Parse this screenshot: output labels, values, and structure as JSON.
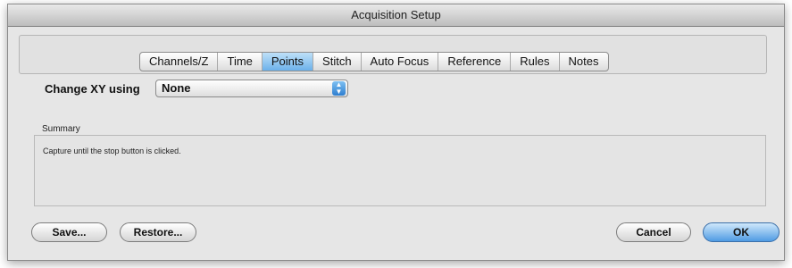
{
  "window": {
    "title": "Acquisition Setup"
  },
  "tabs": [
    {
      "label": "Channels/Z",
      "selected": false
    },
    {
      "label": "Time",
      "selected": false
    },
    {
      "label": "Points",
      "selected": true
    },
    {
      "label": "Stitch",
      "selected": false
    },
    {
      "label": "Auto Focus",
      "selected": false
    },
    {
      "label": "Reference",
      "selected": false
    },
    {
      "label": "Rules",
      "selected": false
    },
    {
      "label": "Notes",
      "selected": false
    }
  ],
  "xy": {
    "label": "Change XY using",
    "value": "None"
  },
  "summary": {
    "label": "Summary",
    "text": "Capture until the stop button is clicked."
  },
  "buttons": {
    "save": "Save...",
    "restore": "Restore...",
    "cancel": "Cancel",
    "ok": "OK"
  }
}
